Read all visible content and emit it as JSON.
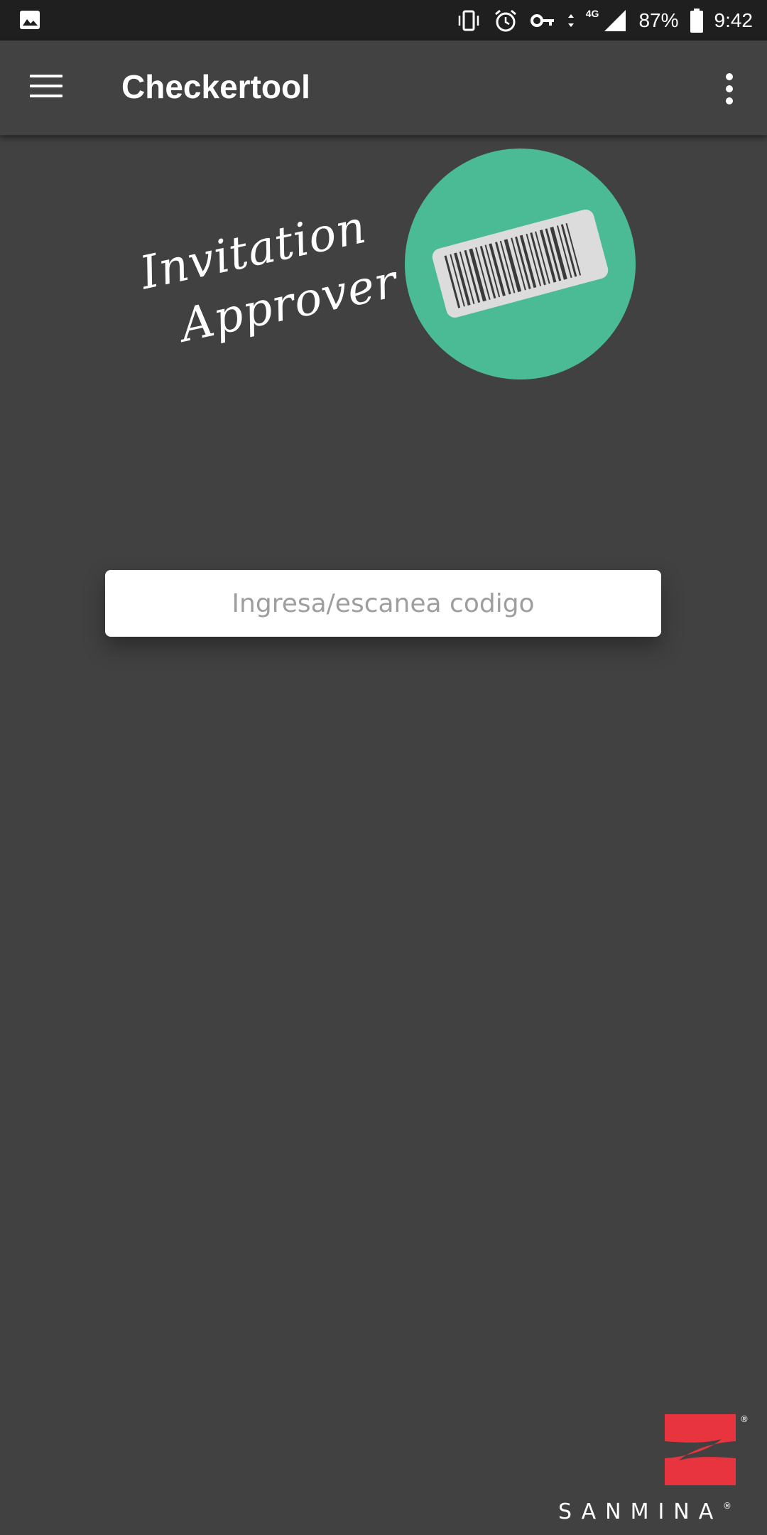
{
  "status_bar": {
    "battery_percent": "87%",
    "time": "9:42",
    "network_type": "4G",
    "icons": [
      "gallery-icon",
      "vibrate-icon",
      "alarm-icon",
      "vpn-key-icon",
      "data-arrows-icon",
      "signal-icon",
      "battery-icon"
    ]
  },
  "toolbar": {
    "title": "Checkertool"
  },
  "hero": {
    "line1": "Invitation",
    "line2": "Approver",
    "badge_color": "#4bbb96"
  },
  "code_input": {
    "placeholder": "Ingresa/escanea codigo",
    "value": ""
  },
  "footer": {
    "logo_text": "SANMINA",
    "logo_color": "#e8343f"
  }
}
